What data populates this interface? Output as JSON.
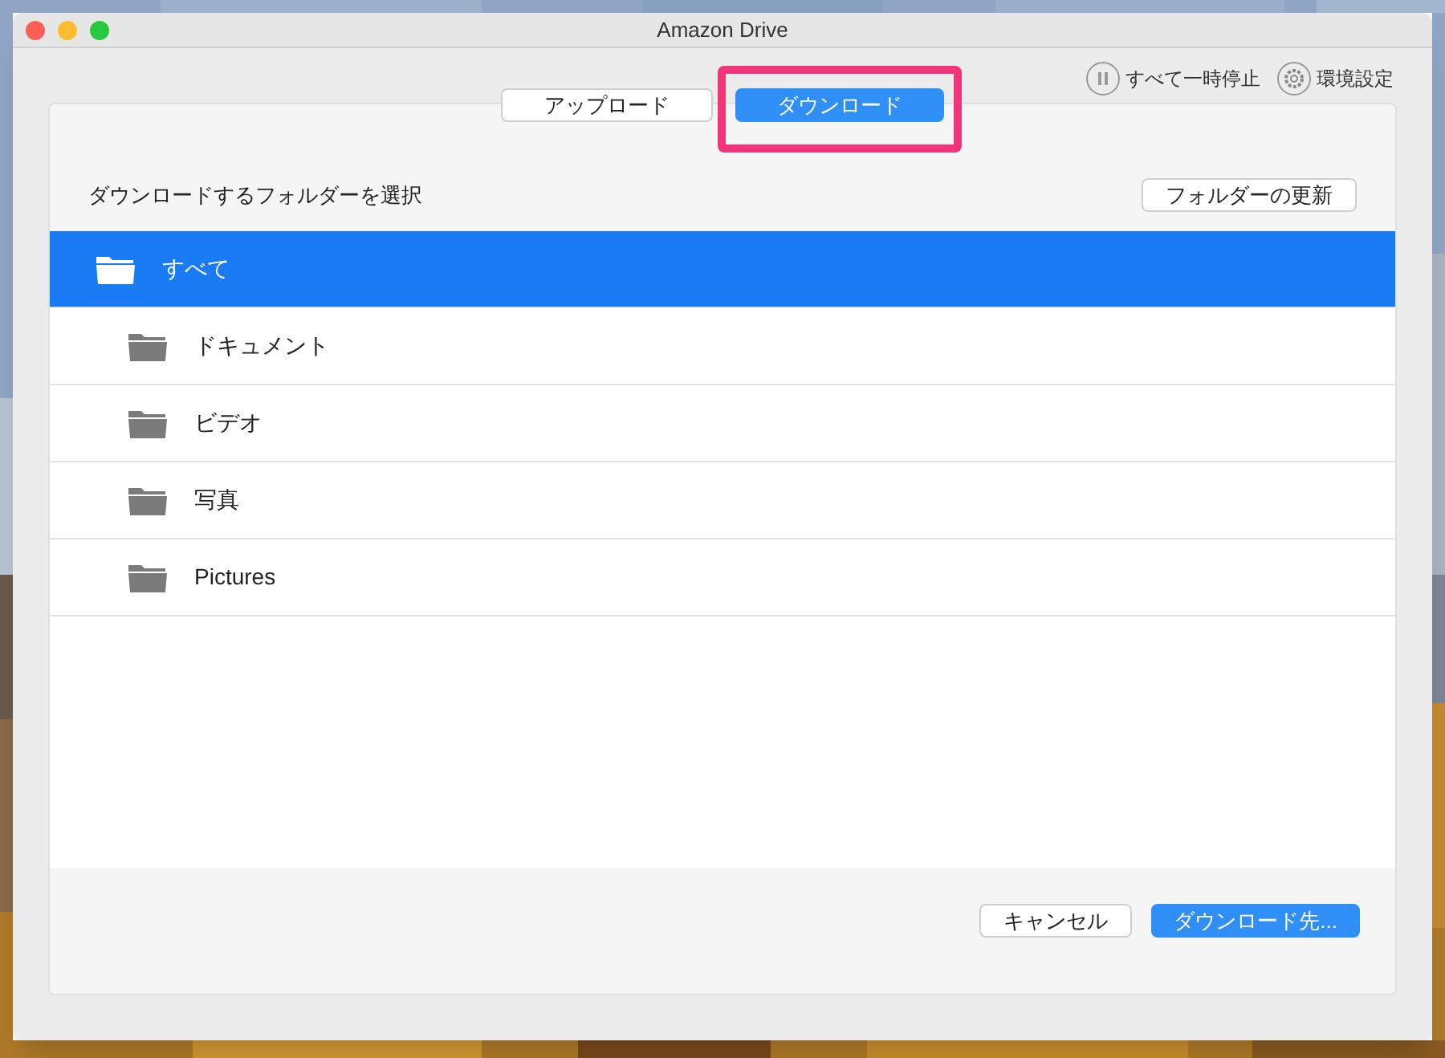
{
  "window": {
    "title": "Amazon Drive"
  },
  "toolbar": [
    {
      "kind": "pause",
      "label": "すべて一時停止"
    },
    {
      "kind": "settings",
      "label": "環境設定"
    }
  ],
  "tabs": [
    {
      "label": "アップロード",
      "selected": false
    },
    {
      "label": "ダウンロード",
      "selected": true,
      "highlighted": true
    }
  ],
  "panel": {
    "heading": "ダウンロードするフォルダーを選択",
    "refresh_button": "フォルダーの更新"
  },
  "folders": [
    {
      "name": "すべて",
      "selected": true,
      "children": [
        {
          "name": "ドキュメント",
          "selected": false
        },
        {
          "name": "ビデオ",
          "selected": false
        },
        {
          "name": "写真",
          "selected": false
        },
        {
          "name": "Pictures",
          "selected": false
        }
      ]
    }
  ],
  "buttons": [
    {
      "label": "キャンセル",
      "kind": "secondary"
    },
    {
      "label": "ダウンロード先...",
      "kind": "primary"
    }
  ]
}
